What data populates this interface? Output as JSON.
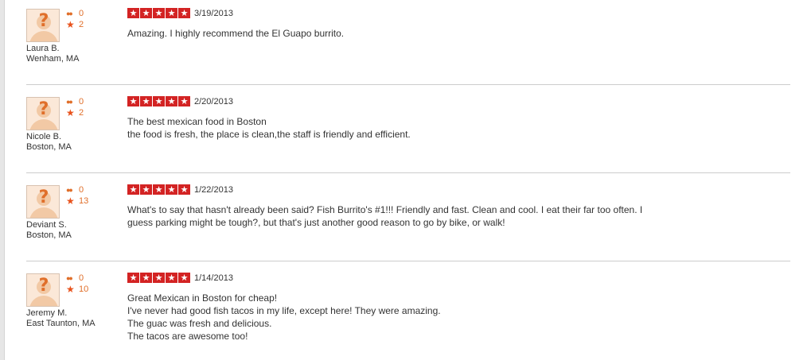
{
  "reviews": [
    {
      "name": "Laura B.",
      "location": "Wenham, MA",
      "friends": "0",
      "reviews": "2",
      "rating": 5,
      "date": "3/19/2013",
      "lines": [
        "Amazing. I highly recommend the El Guapo burrito."
      ]
    },
    {
      "name": "Nicole B.",
      "location": "Boston, MA",
      "friends": "0",
      "reviews": "2",
      "rating": 5,
      "date": "2/20/2013",
      "lines": [
        "The best mexican food in Boston",
        "the food is fresh, the place is clean,the staff is friendly and efficient."
      ]
    },
    {
      "name": "Deviant S.",
      "location": "Boston, MA",
      "friends": "0",
      "reviews": "13",
      "rating": 5,
      "date": "1/22/2013",
      "lines": [
        "What's to say that hasn't already been said? Fish Burrito's #1!!! Friendly and fast. Clean and cool. I eat their far too often. I guess parking might be tough?, but that's just another good reason to go by bike, or walk!"
      ]
    },
    {
      "name": "Jeremy M.",
      "location": "East Taunton, MA",
      "friends": "0",
      "reviews": "10",
      "rating": 5,
      "date": "1/14/2013",
      "lines": [
        "Great Mexican in Boston for cheap!",
        "I've never had good fish tacos in my life, except here! They were amazing.",
        "The guac was fresh and delicious.",
        "The tacos are awesome too!"
      ]
    }
  ],
  "icons": {
    "avatar": "default-avatar-icon",
    "friends": "friends-icon",
    "reviews": "star-icon",
    "rating_star": "rating-star-icon"
  },
  "colors": {
    "rating_red": "#d32323",
    "stat_orange": "#e06f2a",
    "separator": "#cccccc"
  }
}
